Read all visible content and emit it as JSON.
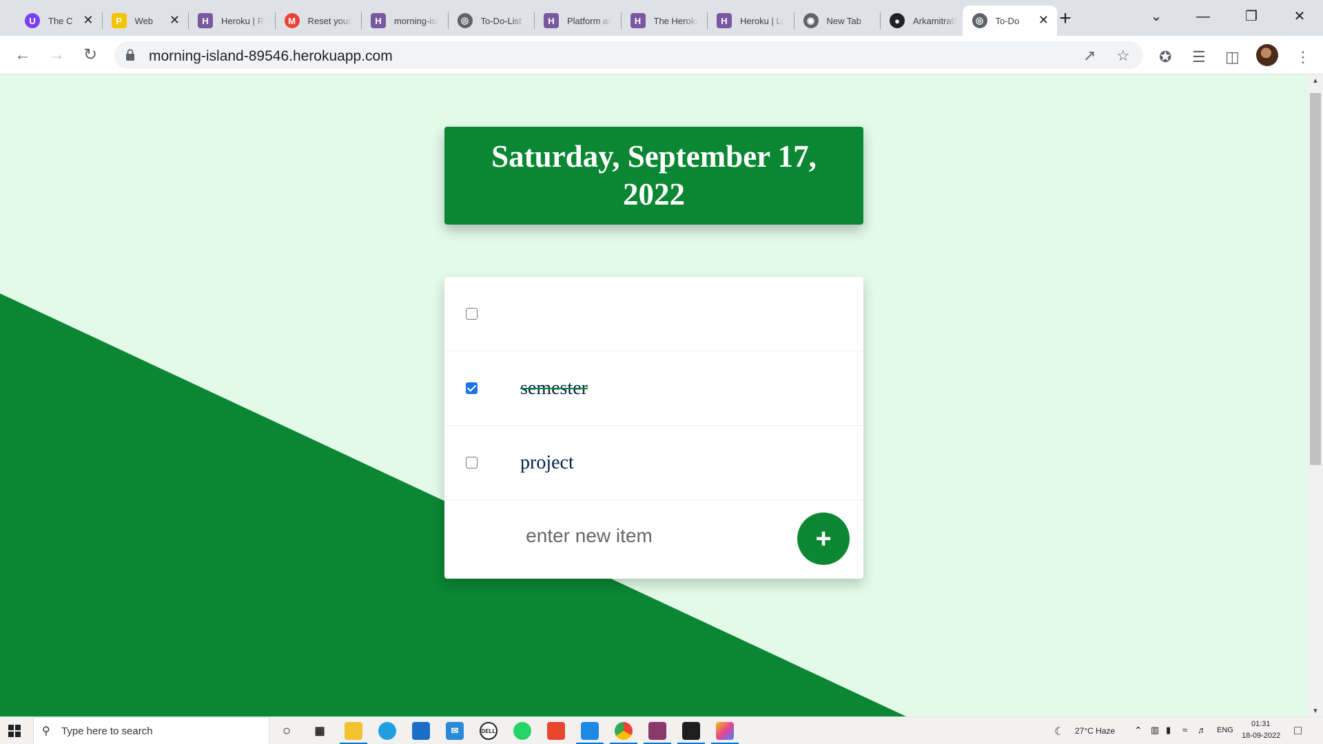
{
  "browser": {
    "tabs": [
      {
        "title": "The C",
        "icon": "purple-circle-icon",
        "color": "#7b3ff2",
        "glyph": "U",
        "active": false,
        "close": true
      },
      {
        "title": "Web",
        "icon": "webflow-icon",
        "color": "#f5c400",
        "glyph": "P",
        "active": false,
        "close": true
      },
      {
        "title": "Heroku | Re",
        "icon": "heroku-icon",
        "color": "#79589f",
        "glyph": "H",
        "active": false,
        "close": false
      },
      {
        "title": "Reset your",
        "icon": "gmail-icon",
        "color": "#ea4335",
        "glyph": "M",
        "active": false,
        "close": false
      },
      {
        "title": "morning-isl",
        "icon": "heroku-icon",
        "color": "#79589f",
        "glyph": "H",
        "active": false,
        "close": false
      },
      {
        "title": "To-Do-List",
        "icon": "globe-icon",
        "color": "#5f6368",
        "glyph": "◎",
        "active": false,
        "close": false
      },
      {
        "title": "Platform as",
        "icon": "heroku-icon",
        "color": "#79589f",
        "glyph": "H",
        "active": false,
        "close": false
      },
      {
        "title": "The Heroku",
        "icon": "heroku-icon",
        "color": "#79589f",
        "glyph": "H",
        "active": false,
        "close": false
      },
      {
        "title": "Heroku | Lo",
        "icon": "heroku-icon",
        "color": "#79589f",
        "glyph": "H",
        "active": false,
        "close": false
      },
      {
        "title": "New Tab",
        "icon": "chrome-icon",
        "color": "#5f6368",
        "glyph": "◉",
        "active": false,
        "close": false
      },
      {
        "title": "Arkamitra02",
        "icon": "github-icon",
        "color": "#202124",
        "glyph": "●",
        "active": false,
        "close": false
      },
      {
        "title": "To-Do",
        "icon": "globe-icon",
        "color": "#5f6368",
        "glyph": "◎",
        "active": true,
        "close": true
      }
    ],
    "new_tab_label": "+",
    "url": "morning-island-89546.herokuapp.com"
  },
  "page": {
    "date_heading": "Saturday, September 17, 2022",
    "items": [
      {
        "text": "",
        "checked": false
      },
      {
        "text": "semester",
        "checked": true
      },
      {
        "text": "project",
        "checked": false
      }
    ],
    "new_item_placeholder": "enter new item",
    "add_button_label": "+",
    "colors": {
      "accent": "#0b8633",
      "background": "#e3fae9",
      "text": "#00204a"
    }
  },
  "taskbar": {
    "search_placeholder": "Type here to search",
    "weather": "27°C  Haze",
    "language": "ENG",
    "time": "01:31",
    "date": "18-09-2022"
  }
}
